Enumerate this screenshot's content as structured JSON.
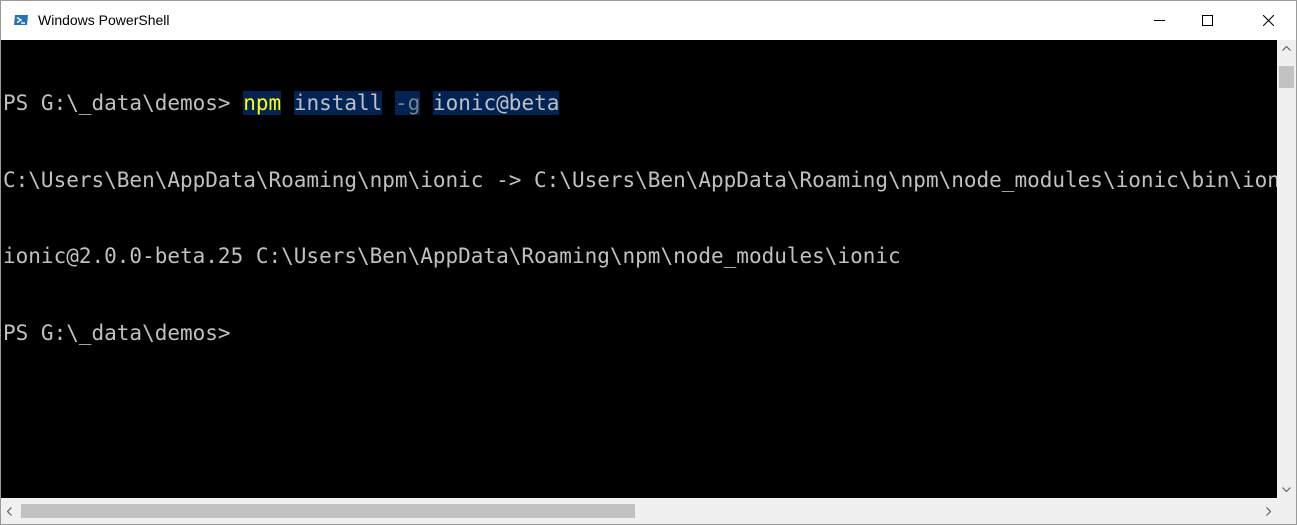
{
  "window": {
    "title": "Windows PowerShell",
    "icon": "powershell-icon"
  },
  "console": {
    "lines": [
      {
        "prompt": "PS G:\\_data\\demos> ",
        "tokens": [
          "npm",
          "install",
          "-g",
          "ionic@beta"
        ]
      },
      {
        "text": "C:\\Users\\Ben\\AppData\\Roaming\\npm\\ionic -> C:\\Users\\Ben\\AppData\\Roaming\\npm\\node_modules\\ionic\\bin\\ionic"
      },
      {
        "text": "ionic@2.0.0-beta.25 C:\\Users\\Ben\\AppData\\Roaming\\npm\\node_modules\\ionic"
      },
      {
        "prompt": "PS G:\\_data\\demos> "
      }
    ]
  },
  "colors": {
    "console_bg": "#000000",
    "text": "#c0c0c0",
    "command": "#ffff00",
    "parameter": "#808080",
    "selection": "#012456"
  }
}
